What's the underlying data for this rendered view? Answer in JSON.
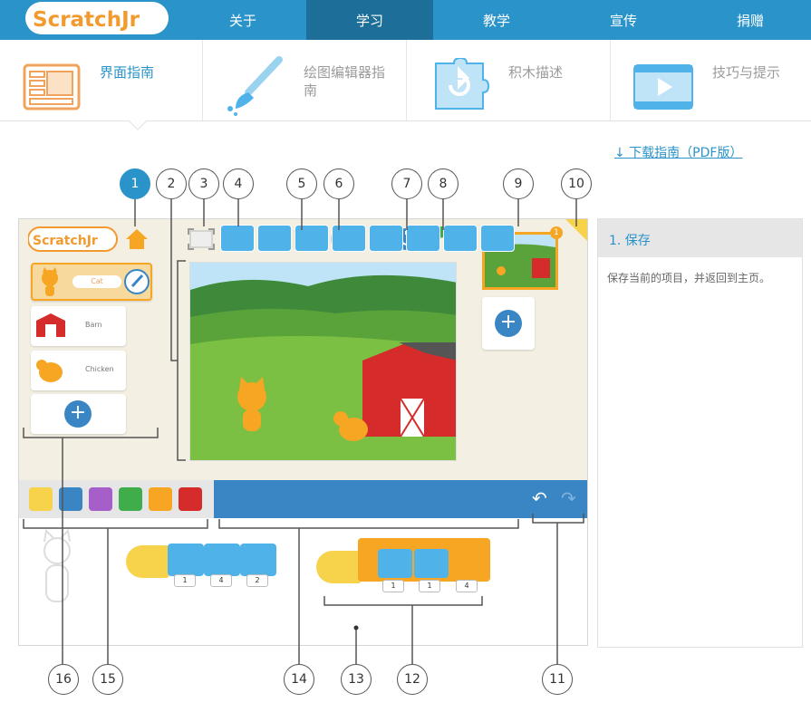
{
  "brand": {
    "logo_text": "ScratchJr"
  },
  "nav": {
    "items": [
      {
        "label": "关于"
      },
      {
        "label": "学习"
      },
      {
        "label": "教学"
      },
      {
        "label": "宣传"
      },
      {
        "label": "捐赠"
      }
    ],
    "active": "学习"
  },
  "guide_tabs": [
    {
      "label": "界面指南",
      "icon": "interface-icon"
    },
    {
      "label": "绘图编辑器指南",
      "icon": "paint-brush-icon"
    },
    {
      "label": "积木描述",
      "icon": "puzzle-block-icon"
    },
    {
      "label": "技巧与提示",
      "icon": "video-tips-icon"
    }
  ],
  "pdf_link": "↓ 下载指南（PDF版）",
  "callouts": [
    "1",
    "2",
    "3",
    "4",
    "5",
    "6",
    "7",
    "8",
    "9",
    "10",
    "11",
    "12",
    "13",
    "14",
    "15",
    "16"
  ],
  "screenshot": {
    "sprites": [
      {
        "name": "Cat"
      },
      {
        "name": "Barn"
      },
      {
        "name": "Chicken"
      }
    ],
    "page_badge": "1",
    "script_numbers": [
      "1",
      "4",
      "2",
      "1",
      "1",
      "4"
    ]
  },
  "info_panel": {
    "title": "1. 保存",
    "body": "保存当前的项目，并返回到主页。"
  },
  "colors": {
    "brand_blue": "#2a93c9",
    "nav_active": "#1d6f99",
    "accent_orange": "#f6a623"
  }
}
